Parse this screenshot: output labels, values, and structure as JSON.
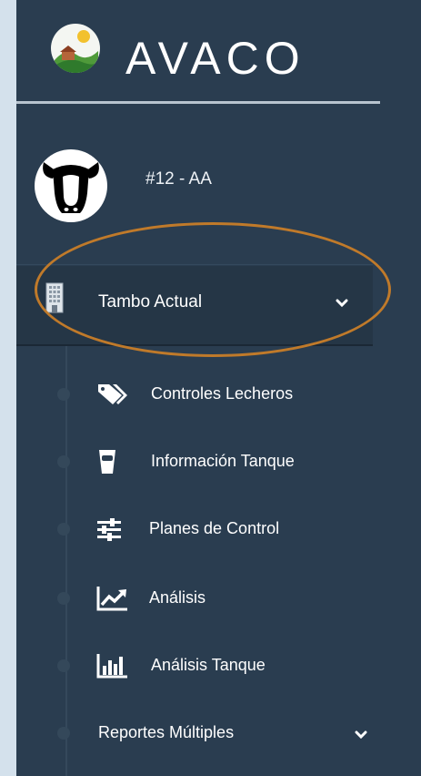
{
  "brand": {
    "name": "AVACO"
  },
  "user": {
    "name": "#12 - AA"
  },
  "menu": {
    "active_item": {
      "label": "Tambo Actual",
      "icon": "building-icon",
      "expanded": true,
      "sub_items": [
        {
          "label": "Controles Lecheros",
          "icon": "tags-icon"
        },
        {
          "label": "Información Tanque",
          "icon": "tank-icon"
        },
        {
          "label": "Planes de Control",
          "icon": "sliders-icon"
        },
        {
          "label": "Análisis",
          "icon": "line-chart-icon"
        },
        {
          "label": "Análisis Tanque",
          "icon": "bar-chart-icon"
        },
        {
          "label": "Reportes Múltiples",
          "icon": "",
          "has_submenu": true
        }
      ]
    }
  },
  "colors": {
    "sidebar_bg": "#2a3d50",
    "page_bg": "#d4e1ec",
    "active_accent": "#20c79b",
    "annotation_ring": "#c07a2a"
  }
}
